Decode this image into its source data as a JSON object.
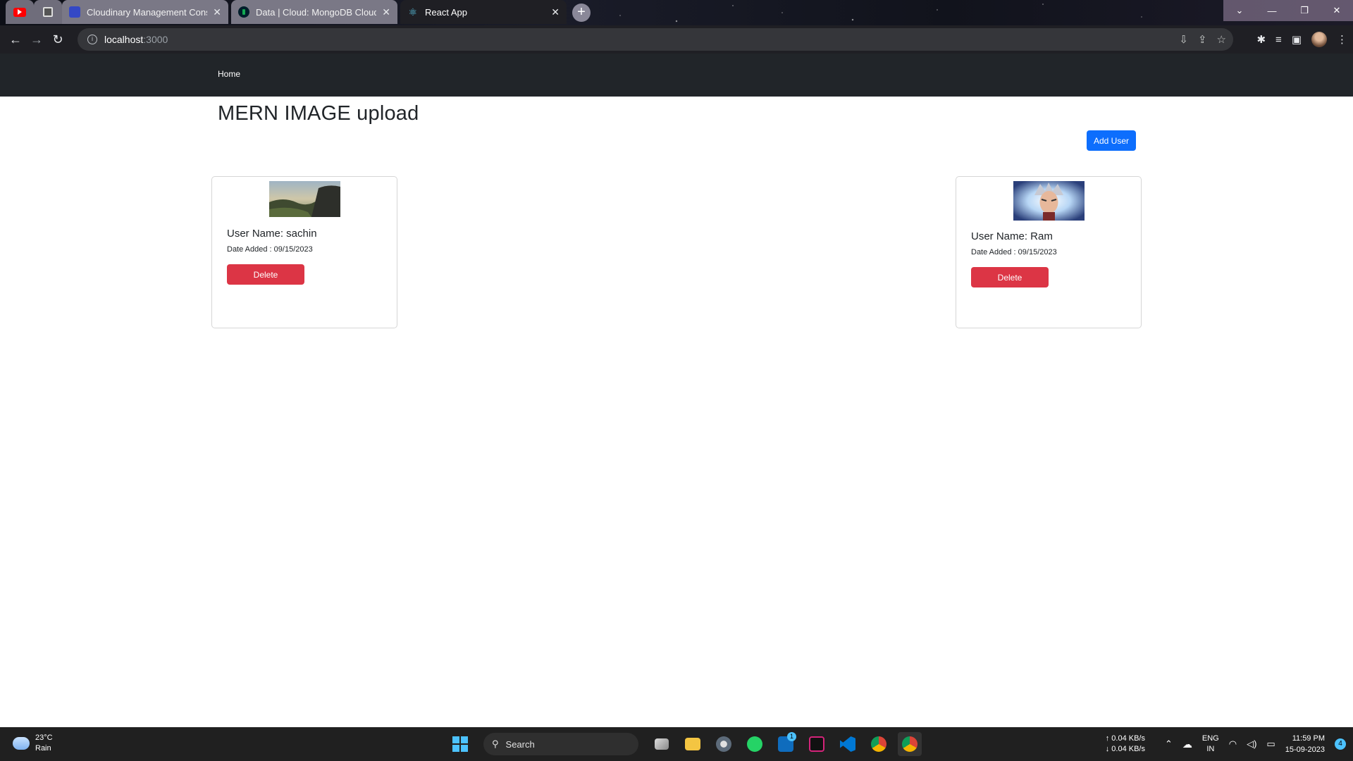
{
  "browser": {
    "tabs": [
      {
        "label": "",
        "favicon": "youtube-icon",
        "pinned": true
      },
      {
        "label": "",
        "favicon": "page-icon",
        "pinned": true
      },
      {
        "label": "Cloudinary Management Conso",
        "favicon": "cloudinary-icon"
      },
      {
        "label": "Data | Cloud: MongoDB Cloud",
        "favicon": "mongodb-leaf-icon"
      },
      {
        "label": "React App",
        "favicon": "react-icon",
        "active": true
      }
    ],
    "address": {
      "host": "localhost",
      "port": ":3000"
    }
  },
  "navbar": {
    "home": "Home"
  },
  "page": {
    "title": "MERN IMAGE upload",
    "add_user_label": "Add User"
  },
  "users": [
    {
      "name_label": "User Name: sachin",
      "date_label": "Date Added : 09/15/2023",
      "delete_label": "Delete",
      "image": "landscape painting thumbnail"
    },
    {
      "name_label": "User Name: Ram",
      "date_label": "Date Added : 09/15/2023",
      "delete_label": "Delete",
      "image": "anime character thumbnail"
    }
  ],
  "taskbar": {
    "weather": {
      "temp": "23°C",
      "condition": "Rain"
    },
    "search_placeholder": "Search",
    "network": {
      "up": "↑ 0.04 KB/s",
      "down": "↓ 0.04 KB/s"
    },
    "language": {
      "line1": "ENG",
      "line2": "IN"
    },
    "clock": {
      "time": "11:59 PM",
      "date": "15-09-2023"
    },
    "notifications": "4",
    "mail_badge": "1"
  },
  "colors": {
    "navbar_bg": "#212529",
    "primary": "#0d6efd",
    "danger": "#dc3545"
  }
}
